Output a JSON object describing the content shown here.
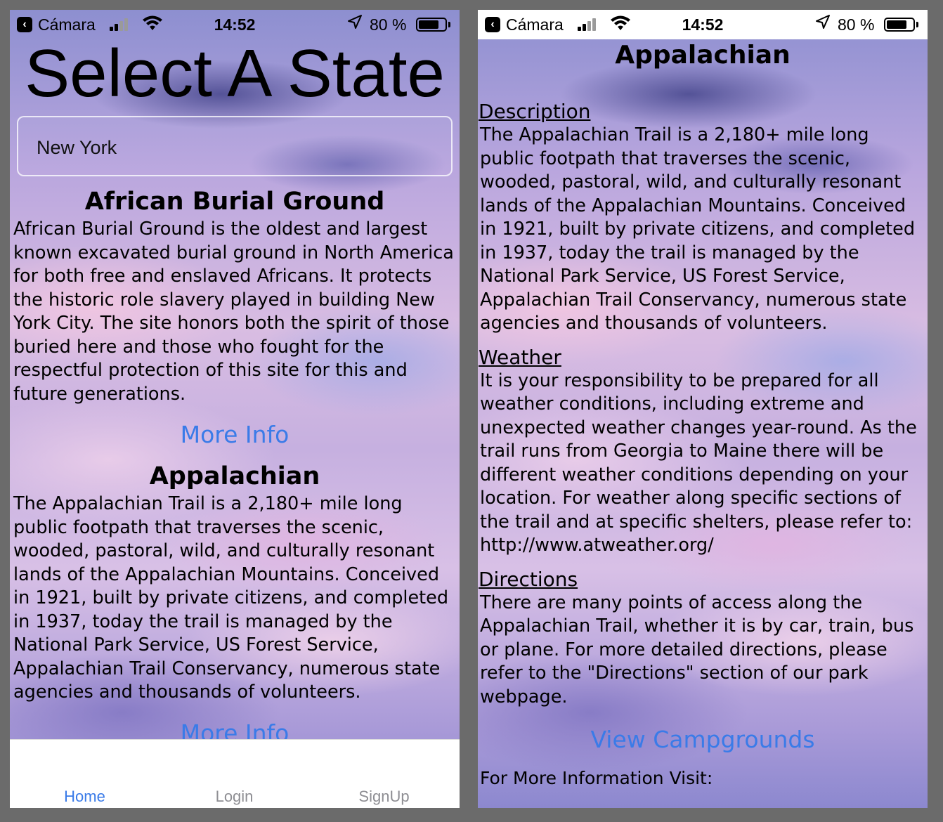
{
  "status_bar": {
    "back_label": "Cámara",
    "time": "14:52",
    "battery": "80 %",
    "battery_level_percent": 80
  },
  "home": {
    "title": "Select A State",
    "search_value": "New York",
    "parks": [
      {
        "name": "African Burial Ground",
        "description": "African Burial Ground is the oldest and largest known excavated burial ground in North America for both free and enslaved Africans. It protects the historic role slavery played in building New York City.  The site honors both the spirit of those buried here and those who fought for the respectful protection of this site for this and future generations.",
        "link": "More Info"
      },
      {
        "name": "Appalachian",
        "description": "The Appalachian Trail is a 2,180+ mile long public footpath that traverses the scenic, wooded, pastoral, wild, and culturally resonant lands of the Appalachian Mountains. Conceived in 1921, built by private citizens, and completed in 1937, today the trail is managed by the National Park Service, US Forest Service, Appalachian Trail Conservancy, numerous state agencies and thousands of volunteers.",
        "link": "More Info"
      }
    ],
    "tabs": [
      "Home",
      "Login",
      "SignUp"
    ]
  },
  "detail": {
    "title": "Appalachian",
    "sections": [
      {
        "heading": "Description",
        "text": "The Appalachian Trail is a 2,180+ mile long public footpath that traverses the scenic, wooded, pastoral, wild, and culturally resonant lands of the Appalachian Mountains. Conceived in 1921, built by private citizens, and completed in 1937, today the trail is managed by the National Park Service, US Forest Service, Appalachian Trail Conservancy, numerous state agencies and thousands of volunteers."
      },
      {
        "heading": "Weather",
        "text": "It is your responsibility to be prepared for all weather conditions, including extreme and unexpected weather changes year-round. As the trail runs from Georgia to Maine there will be different weather conditions depending on your location. For weather along specific sections of the trail and at specific shelters, please refer to: http://www.atweather.org/"
      },
      {
        "heading": "Directions",
        "text": "There are many points of access along the Appalachian Trail, whether it is by car, train, bus or plane. For more detailed directions, please refer to the \"Directions\" section of our park webpage."
      }
    ],
    "campgrounds_link": "View Campgrounds",
    "more_visit": "For More Information Visit:"
  },
  "colors": {
    "link": "#3a7be8",
    "tab_inactive": "#8e8e93",
    "background": "#6b6b6b"
  }
}
